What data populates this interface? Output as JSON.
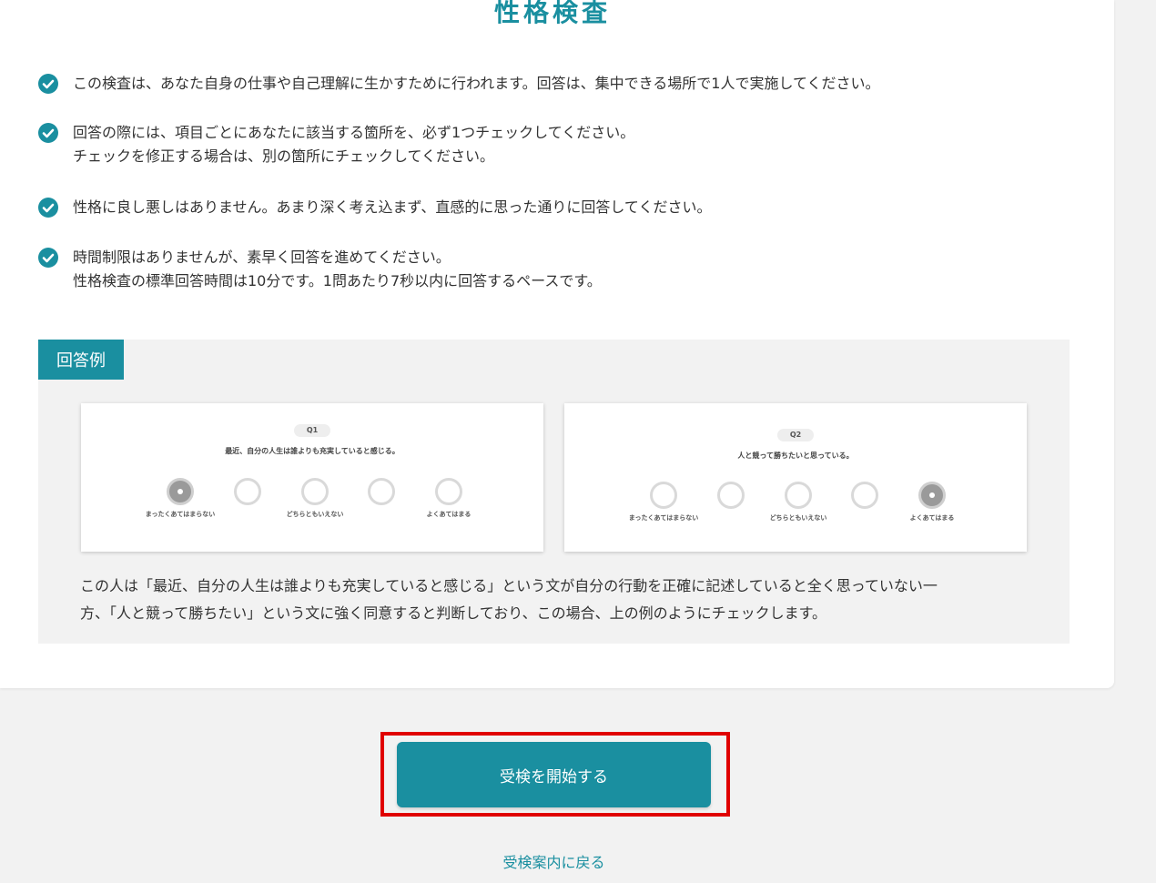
{
  "page": {
    "title": "性格検査"
  },
  "instructions": [
    {
      "lines": [
        "この検査は、あなた自身の仕事や自己理解に生かすために行われます。回答は、集中できる場所で1人で実施してください。"
      ]
    },
    {
      "lines": [
        "回答の際には、項目ごとにあなたに該当する箇所を、必ず1つチェックしてください。",
        "チェックを修正する場合は、別の箇所にチェックしてください。"
      ]
    },
    {
      "lines": [
        "性格に良し悪しはありません。あまり深く考え込まず、直感的に思った通りに回答してください。"
      ]
    },
    {
      "lines": [
        "時間制限はありませんが、素早く回答を進めてください。",
        "性格検査の標準回答時間は10分です。1問あたり7秒以内に回答するペースです。"
      ]
    }
  ],
  "example": {
    "tag": "回答例",
    "questions": [
      {
        "badge": "Q1",
        "text": "最近、自分の人生は誰よりも充実していると感じる。",
        "options": 5,
        "selected_index": 0,
        "labels": {
          "left": "まったくあてはまらない",
          "middle": "どちらともいえない",
          "right": "よくあてはまる"
        }
      },
      {
        "badge": "Q2",
        "text": "人と競って勝ちたいと思っている。",
        "options": 5,
        "selected_index": 4,
        "labels": {
          "left": "まったくあてはまらない",
          "middle": "どちらともいえない",
          "right": "よくあてはまる"
        }
      }
    ],
    "description_lines": [
      "この人は「最近、自分の人生は誰よりも充実していると感じる」という文が自分の行動を正確に記述していると全く思っていない一",
      "方、「人と競って勝ちたい」という文に強く同意すると判断しており、この場合、上の例のようにチェックします。"
    ]
  },
  "actions": {
    "start_label": "受検を開始する",
    "back_label": "受検案内に戻る"
  },
  "colors": {
    "accent": "#1a8fa0",
    "highlight": "#e00000"
  }
}
